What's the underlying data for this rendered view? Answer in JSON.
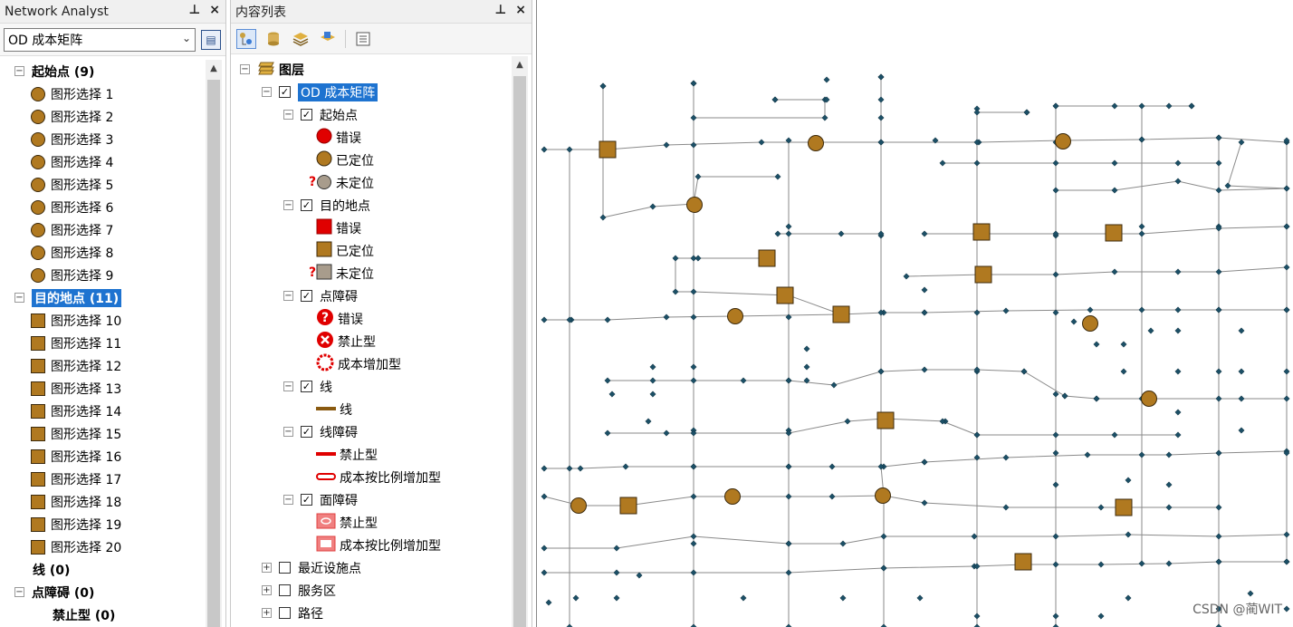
{
  "network_analyst": {
    "title": "Network Analyst",
    "pin": "⊥",
    "close": "×",
    "layer_select": "OD 成本矩阵",
    "origins": {
      "label": "起始点 (9)",
      "items": [
        "图形选择 1",
        "图形选择 2",
        "图形选择 3",
        "图形选择 4",
        "图形选择 5",
        "图形选择 6",
        "图形选择 7",
        "图形选择 8",
        "图形选择 9"
      ]
    },
    "destinations": {
      "label": "目的地点 (11)",
      "items": [
        "图形选择 10",
        "图形选择 11",
        "图形选择 12",
        "图形选择 13",
        "图形选择 14",
        "图形选择 15",
        "图形选择 16",
        "图形选择 17",
        "图形选择 18",
        "图形选择 19",
        "图形选择 20"
      ]
    },
    "lines": {
      "label": "线 (0)"
    },
    "point_barriers": {
      "label": "点障碍 (0)"
    },
    "restriction": {
      "label": "禁止型 (0)"
    }
  },
  "toc": {
    "title": "内容列表",
    "pin": "⊥",
    "close": "×",
    "layers_root": "图层",
    "od_layer": "OD 成本矩阵",
    "origins": {
      "label": "起始点",
      "error": "错误",
      "located": "已定位",
      "unlocated": "未定位"
    },
    "destinations": {
      "label": "目的地点",
      "error": "错误",
      "located": "已定位",
      "unlocated": "未定位"
    },
    "point_barriers": {
      "label": "点障碍",
      "error": "错误",
      "restriction": "禁止型",
      "added_cost": "成本增加型"
    },
    "lines": {
      "label": "线",
      "item": "线"
    },
    "line_barriers": {
      "label": "线障碍",
      "restriction": "禁止型",
      "scaled_cost": "成本按比例增加型"
    },
    "polygon_barriers": {
      "label": "面障碍",
      "restriction": "禁止型",
      "scaled_cost": "成本按比例增加型"
    },
    "other_layers": [
      "最近设施点",
      "服务区",
      "路径"
    ]
  },
  "colors": {
    "located": "#b07920",
    "error": "#e00000",
    "unlocated": "#a89c8c",
    "node": "#1b4f66",
    "edge": "#8a8a8a"
  },
  "watermark": "CSDN @蔺WIT"
}
